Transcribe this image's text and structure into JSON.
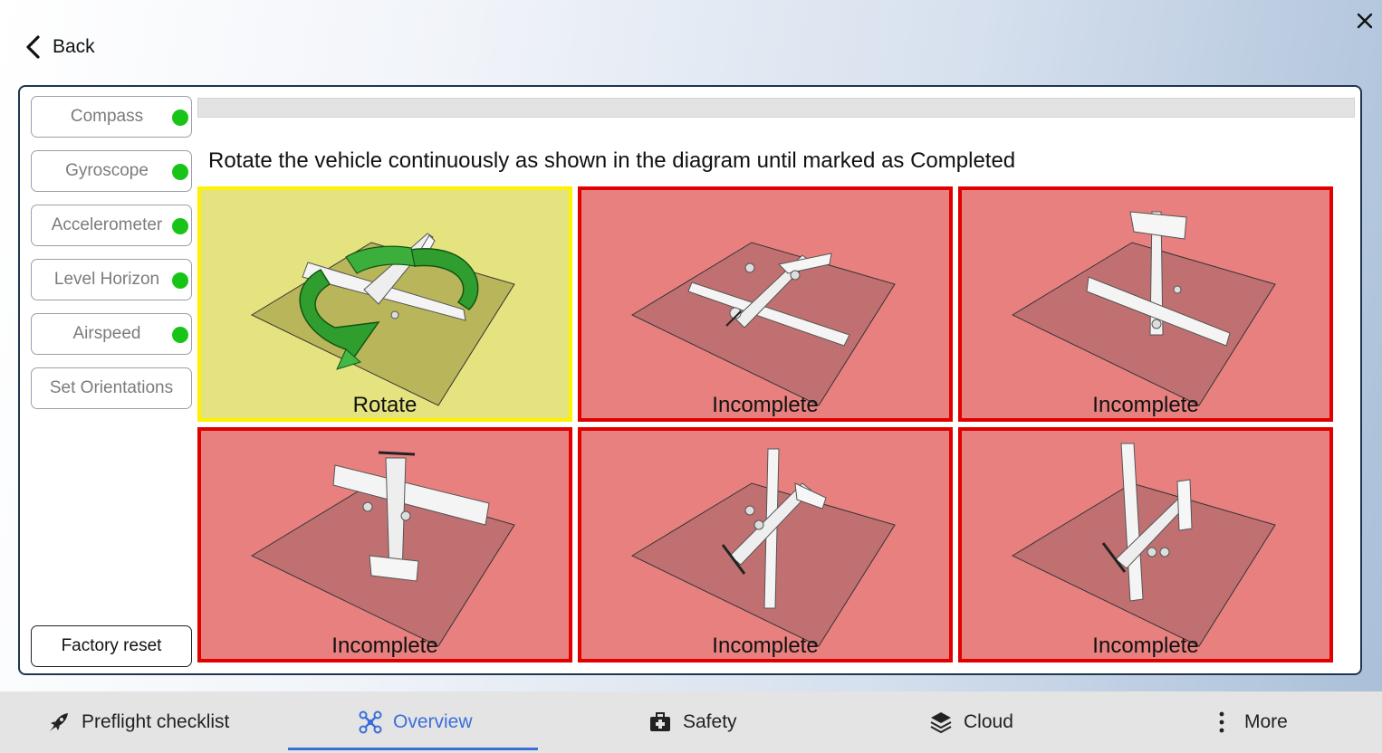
{
  "nav": {
    "back_label": "Back",
    "back_icon": "chevron-left-icon",
    "close_icon": "close-icon"
  },
  "sidebar": {
    "items": [
      {
        "label": "Compass",
        "status": "complete",
        "status_color": "#19c419"
      },
      {
        "label": "Gyroscope",
        "status": "complete",
        "status_color": "#19c419"
      },
      {
        "label": "Accelerometer",
        "status": "complete",
        "status_color": "#19c419"
      },
      {
        "label": "Level Horizon",
        "status": "complete",
        "status_color": "#19c419"
      },
      {
        "label": "Airspeed",
        "status": "complete",
        "status_color": "#19c419"
      },
      {
        "label": "Set Orientations"
      }
    ],
    "factory_reset_label": "Factory reset"
  },
  "calibration": {
    "progress": 0,
    "instruction": "Rotate the vehicle continuously as shown in the diagram until marked as Completed",
    "orientations": [
      {
        "status": "Rotate",
        "state": "active",
        "picture": "rotate-arrow-aircraft"
      },
      {
        "status": "Incomplete",
        "state": "incomplete",
        "picture": "aircraft-level"
      },
      {
        "status": "Incomplete",
        "state": "incomplete",
        "picture": "aircraft-nose-down"
      },
      {
        "status": "Incomplete",
        "state": "incomplete",
        "picture": "aircraft-upside-down"
      },
      {
        "status": "Incomplete",
        "state": "incomplete",
        "picture": "aircraft-right-wing-down"
      },
      {
        "status": "Incomplete",
        "state": "incomplete",
        "picture": "aircraft-left-wing-down"
      }
    ],
    "colors": {
      "active_border": "#fff200",
      "active_fill": "#e4e380",
      "incomplete_border": "#e00000",
      "incomplete_fill": "#e88080"
    }
  },
  "tabbar": {
    "tabs": [
      {
        "label": "Preflight checklist",
        "icon": "rocket-icon"
      },
      {
        "label": "Overview",
        "icon": "drone-icon",
        "active": true
      },
      {
        "label": "Safety",
        "icon": "medkit-icon"
      },
      {
        "label": "Cloud",
        "icon": "layers-icon"
      },
      {
        "label": "More",
        "icon": "dots-vertical-icon"
      }
    ],
    "accent": "#3a6fd8"
  }
}
